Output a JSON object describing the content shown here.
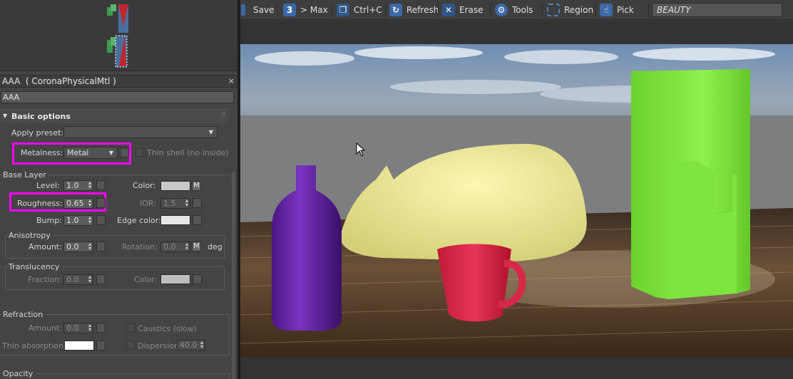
{
  "material_editor": {
    "title": "AAA  ( CoronaPhysicalMtl )",
    "close_glyph": "×",
    "name_value": "AAA",
    "rollout": "Basic options",
    "apply_preset_label": "Apply preset:",
    "apply_preset_value": "",
    "metalness_label": "Metalness:",
    "metalness_value": "Metal",
    "thin_shell_label": "Thin shell (no inside)",
    "base_layer": {
      "title": "Base Layer",
      "level_label": "Level:",
      "level_value": "1.0",
      "color_label": "Color:",
      "color_map_button": "M",
      "roughness_label": "Roughness:",
      "roughness_value": "0.65",
      "ior_label": "IOR:",
      "ior_value": "1.5",
      "bump_label": "Bump:",
      "bump_value": "1.0",
      "edge_color_label": "Edge color:"
    },
    "anisotropy": {
      "title": "Anisotropy",
      "amount_label": "Amount:",
      "amount_value": "0.0",
      "rotation_label": "Rotation:",
      "rotation_value": "0.0",
      "map_button": "M",
      "unit": "deg"
    },
    "translucency": {
      "title": "Translucency",
      "fraction_label": "Fraction:",
      "fraction_value": "0.0",
      "color_label": "Color:"
    },
    "refraction": {
      "title": "Refraction",
      "amount_label": "Amount:",
      "amount_value": "0.0",
      "caustics_label": "Caustics (slow)",
      "thin_absorption_label": "Thin absorption:",
      "dispersion_label": "Dispersion",
      "dispersion_value": "40.0"
    },
    "opacity_title": "Opacity"
  },
  "vfb_toolbar": {
    "save": "Save",
    "max": "> Max",
    "copy": "Ctrl+C",
    "refresh": "Refresh",
    "erase": "Erase",
    "tools": "Tools",
    "region": "Region",
    "pick": "Pick",
    "channel": "BEAUTY"
  },
  "colors": {
    "highlight": "#ff00ff",
    "accent": "#3c68a5",
    "swatch_grey": "#c8c8c8",
    "swatch_white": "#ffffff"
  },
  "icons": [
    "save-icon",
    "max-icon",
    "copy-icon",
    "refresh-icon",
    "erase-icon",
    "tools-icon",
    "region-icon",
    "pick-icon"
  ]
}
